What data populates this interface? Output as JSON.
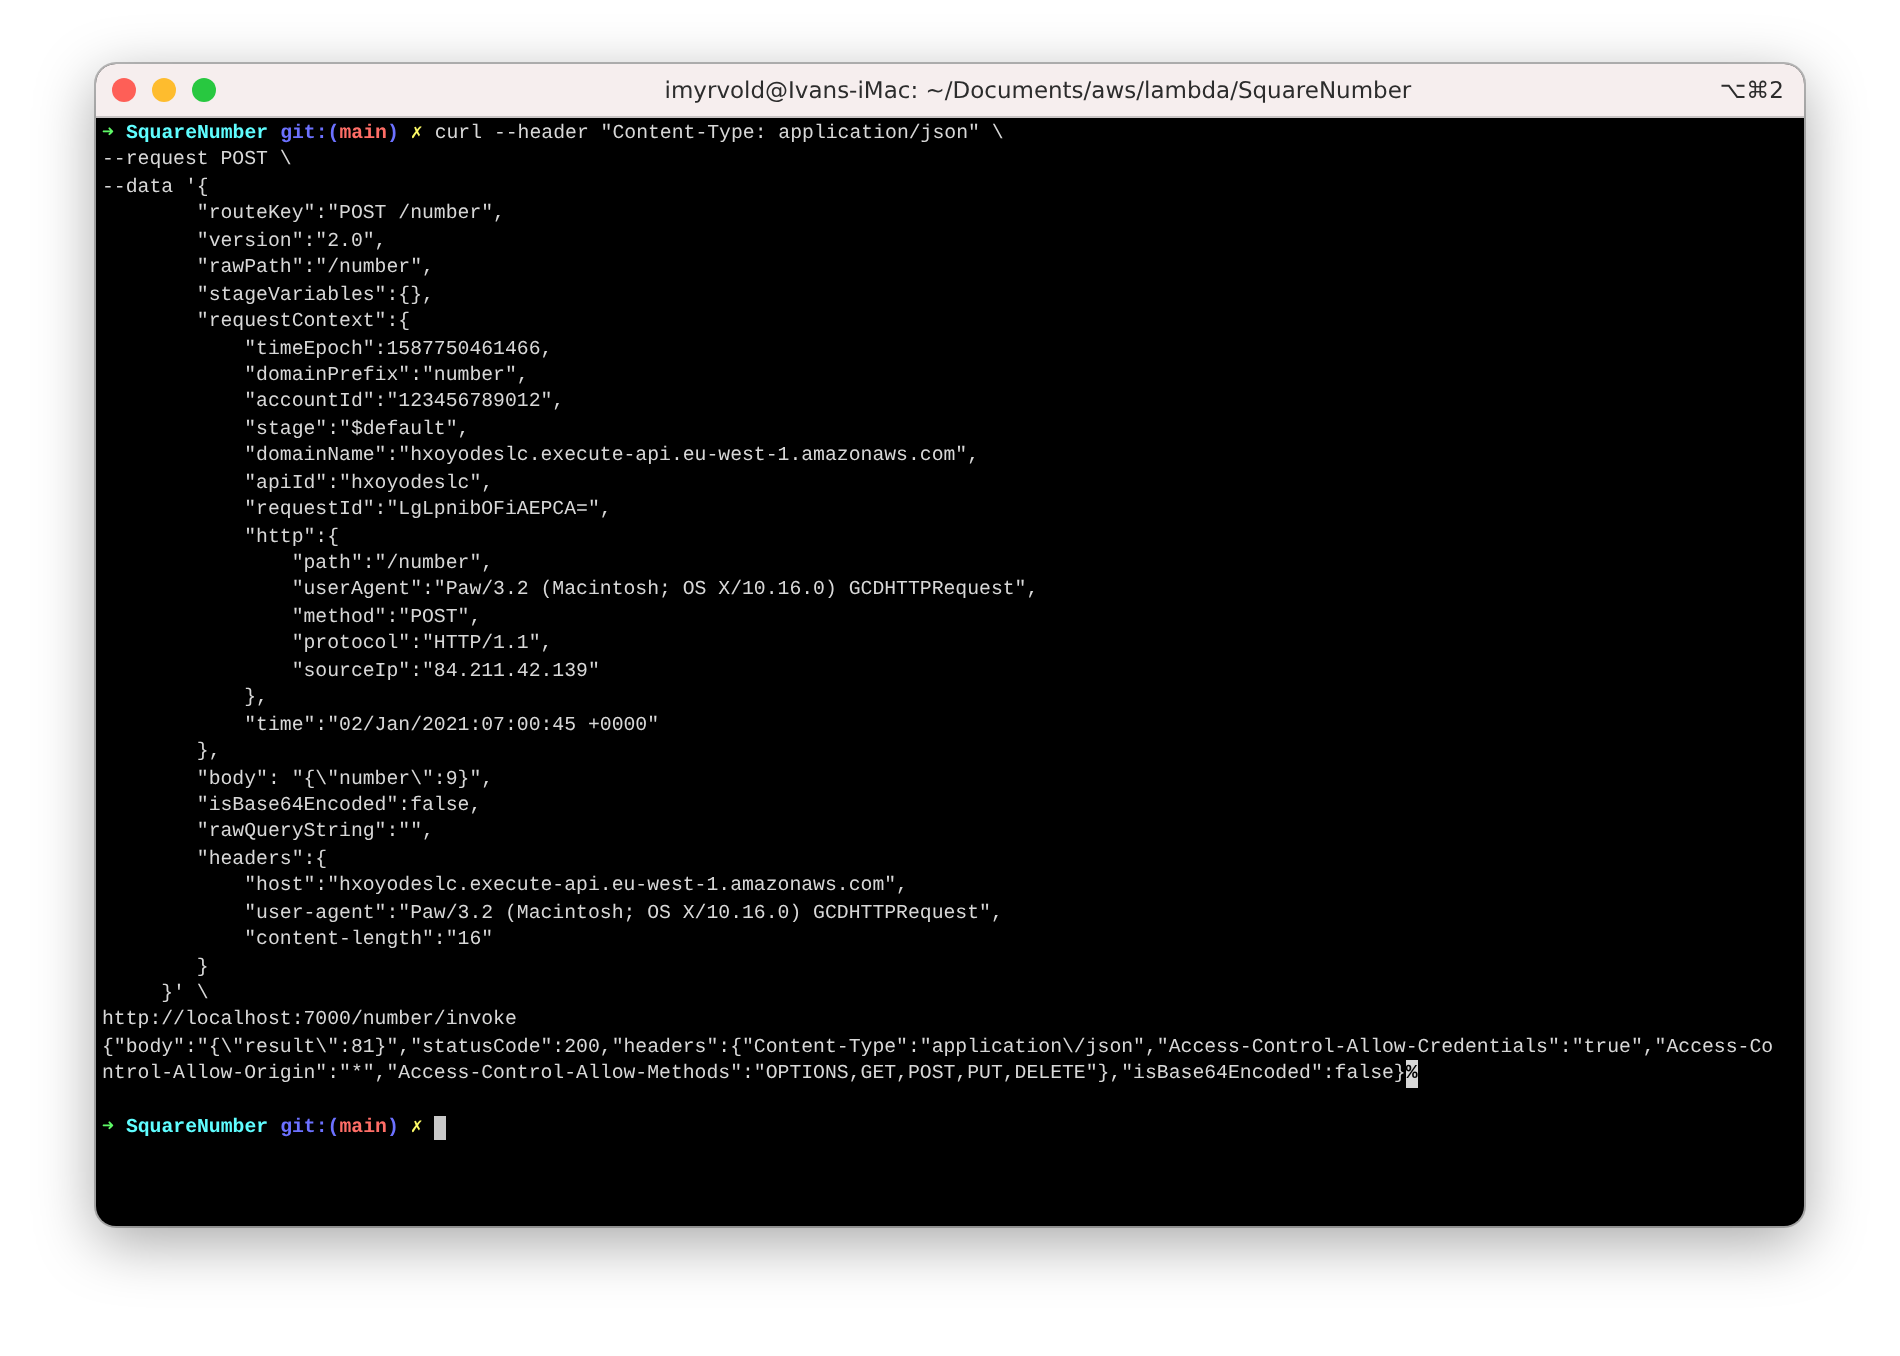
{
  "window": {
    "title": "imyrvold@Ivans-iMac: ~/Documents/aws/lambda/SquareNumber",
    "shortcut": "⌥⌘2"
  },
  "lines": [
    {
      "kind": "prompt",
      "arrow": "➜",
      "dir": "SquareNumber",
      "git_open": "git:(",
      "branch": "main",
      "git_close": ")",
      "dirty": "✗",
      "command": "curl --header \"Content-Type: application/json\" \\"
    },
    {
      "kind": "text",
      "text": "--request POST \\"
    },
    {
      "kind": "text",
      "text": "--data '{"
    },
    {
      "kind": "text",
      "text": "        \"routeKey\":\"POST /number\","
    },
    {
      "kind": "text",
      "text": "        \"version\":\"2.0\","
    },
    {
      "kind": "text",
      "text": "        \"rawPath\":\"/number\","
    },
    {
      "kind": "text",
      "text": "        \"stageVariables\":{},"
    },
    {
      "kind": "text",
      "text": "        \"requestContext\":{"
    },
    {
      "kind": "text",
      "text": "            \"timeEpoch\":1587750461466,"
    },
    {
      "kind": "text",
      "text": "            \"domainPrefix\":\"number\","
    },
    {
      "kind": "text",
      "text": "            \"accountId\":\"123456789012\","
    },
    {
      "kind": "text",
      "text": "            \"stage\":\"$default\","
    },
    {
      "kind": "text",
      "text": "            \"domainName\":\"hxoyodeslc.execute-api.eu-west-1.amazonaws.com\","
    },
    {
      "kind": "text",
      "text": "            \"apiId\":\"hxoyodeslc\","
    },
    {
      "kind": "text",
      "text": "            \"requestId\":\"LgLpnibOFiAEPCA=\","
    },
    {
      "kind": "text",
      "text": "            \"http\":{"
    },
    {
      "kind": "text",
      "text": "                \"path\":\"/number\","
    },
    {
      "kind": "text",
      "text": "                \"userAgent\":\"Paw/3.2 (Macintosh; OS X/10.16.0) GCDHTTPRequest\","
    },
    {
      "kind": "text",
      "text": "                \"method\":\"POST\","
    },
    {
      "kind": "text",
      "text": "                \"protocol\":\"HTTP/1.1\","
    },
    {
      "kind": "text",
      "text": "                \"sourceIp\":\"84.211.42.139\""
    },
    {
      "kind": "text",
      "text": "            },"
    },
    {
      "kind": "text",
      "text": "            \"time\":\"02/Jan/2021:07:00:45 +0000\""
    },
    {
      "kind": "text",
      "text": "        },"
    },
    {
      "kind": "text",
      "text": "        \"body\": \"{\\\"number\\\":9}\","
    },
    {
      "kind": "text",
      "text": "        \"isBase64Encoded\":false,"
    },
    {
      "kind": "text",
      "text": "        \"rawQueryString\":\"\","
    },
    {
      "kind": "text",
      "text": "        \"headers\":{"
    },
    {
      "kind": "text",
      "text": "            \"host\":\"hxoyodeslc.execute-api.eu-west-1.amazonaws.com\","
    },
    {
      "kind": "text",
      "text": "            \"user-agent\":\"Paw/3.2 (Macintosh; OS X/10.16.0) GCDHTTPRequest\","
    },
    {
      "kind": "text",
      "text": "            \"content-length\":\"16\""
    },
    {
      "kind": "text",
      "text": "        }"
    },
    {
      "kind": "text",
      "text": "     }' \\"
    },
    {
      "kind": "text",
      "text": "http://localhost:7000/number/invoke"
    },
    {
      "kind": "text",
      "text": "{\"body\":\"{\\\"result\\\":81}\",\"statusCode\":200,\"headers\":{\"Content-Type\":\"application\\/json\",\"Access-Control-Allow-Credentials\":\"true\",\"Access-Co"
    },
    {
      "kind": "text",
      "text": "ntrol-Allow-Origin\":\"*\",\"Access-Control-Allow-Methods\":\"OPTIONS,GET,POST,PUT,DELETE\"},\"isBase64Encoded\":false}",
      "end_mark": "%"
    },
    {
      "kind": "blank"
    },
    {
      "kind": "prompt",
      "arrow": "➜",
      "dir": "SquareNumber",
      "git_open": "git:(",
      "branch": "main",
      "git_close": ")",
      "dirty": "✗",
      "cursor": true
    }
  ]
}
